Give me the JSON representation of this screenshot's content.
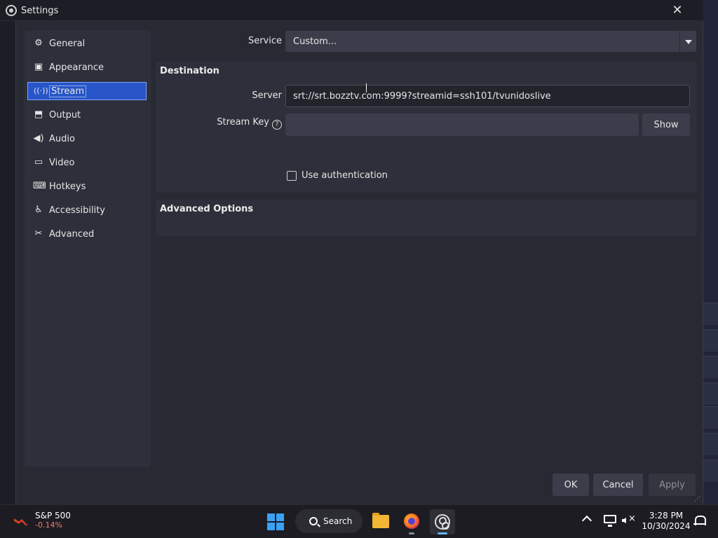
{
  "window": {
    "title": "Settings",
    "close_glyph": "✕"
  },
  "sidebar": {
    "items": [
      {
        "label": "General",
        "icon": "gear-icon",
        "glyph": "⚙"
      },
      {
        "label": "Appearance",
        "icon": "appearance-icon",
        "glyph": "▣"
      },
      {
        "label": "Stream",
        "icon": "antenna-icon",
        "glyph": "📶",
        "active": true
      },
      {
        "label": "Output",
        "icon": "output-icon",
        "glyph": "⬒"
      },
      {
        "label": "Audio",
        "icon": "speaker-icon",
        "glyph": "🔊"
      },
      {
        "label": "Video",
        "icon": "monitor-icon",
        "glyph": "▭"
      },
      {
        "label": "Hotkeys",
        "icon": "keyboard-icon",
        "glyph": "⌨"
      },
      {
        "label": "Accessibility",
        "icon": "accessibility-icon",
        "glyph": "♿"
      },
      {
        "label": "Advanced",
        "icon": "tools-icon",
        "glyph": "✂"
      }
    ]
  },
  "stream": {
    "service_label": "Service",
    "service_value": "Custom...",
    "destination_title": "Destination",
    "server_label": "Server",
    "server_value": "srt://srt.bozztv.com:9999?streamid=ssh101/tvunidoslive",
    "stream_key_label": "Stream Key",
    "stream_key_value": "",
    "help_glyph": "?",
    "show_button": "Show",
    "use_auth_label": "Use authentication",
    "use_auth_checked": false,
    "advanced_title": "Advanced Options"
  },
  "buttons": {
    "ok": "OK",
    "cancel": "Cancel",
    "apply": "Apply",
    "apply_enabled": false
  },
  "taskbar": {
    "widget_ticker": "S&P 500",
    "widget_change": "-0.14%",
    "search_label": "Search",
    "time": "3:28 PM",
    "date": "10/30/2024"
  },
  "colors": {
    "accent": "#2856c8",
    "dialog_bg": "#272a33",
    "panel_bg": "#2d303a",
    "negative": "#f07a6e"
  }
}
